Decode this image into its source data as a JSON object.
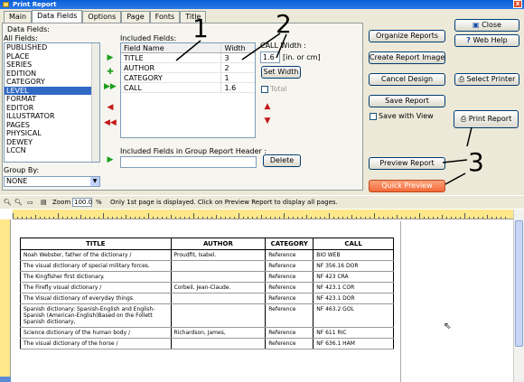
{
  "window": {
    "title": "Print Report",
    "close_glyph": "x"
  },
  "tabs": [
    {
      "label": "Main"
    },
    {
      "label": "Data Fields"
    },
    {
      "label": "Options"
    },
    {
      "label": "Page"
    },
    {
      "label": "Fonts"
    },
    {
      "label": "Title"
    }
  ],
  "data_fields": {
    "group_label": "Data Fields:",
    "all_fields_label": "All Fields:",
    "all_fields": [
      "PUBLISHED",
      "PLACE",
      "SERIES",
      "EDITION",
      "CATEGORY",
      "LEVEL",
      "FORMAT",
      "EDITOR",
      "ILLUSTRATOR",
      "PAGES",
      "PHYSICAL",
      "DEWEY",
      "LCCN"
    ],
    "selected_field": "LEVEL",
    "included_label": "Included Fields:",
    "columns": [
      "Field Name",
      "Width"
    ],
    "included": [
      {
        "name": "TITLE",
        "width": "3"
      },
      {
        "name": "AUTHOR",
        "width": "2"
      },
      {
        "name": "CATEGORY",
        "width": "1"
      },
      {
        "name": "CALL",
        "width": "1.6"
      }
    ],
    "call_width_label": "CALL Width :",
    "call_width_value": "1.6",
    "units_label": "[in. or cm]",
    "set_width": "Set Width",
    "total_label": "Total",
    "group_header_label": "Included Fields in Group Report Header :",
    "delete": "Delete",
    "group_by_label": "Group By:",
    "group_by_value": "NONE"
  },
  "side_buttons": {
    "organize": "Organize Reports",
    "create_image": "Create Report Image",
    "cancel_design": "Cancel Design",
    "save_report": "Save Report",
    "save_with_view": "Save with View",
    "preview_report": "Preview Report",
    "quick_preview": "Quick Preview",
    "close": "Close",
    "web_help": "Web Help",
    "select_printer": "Select Printer",
    "print_report": "Print Report"
  },
  "toolbar": {
    "zoom_label": "Zoom",
    "zoom_value": "100.0",
    "percent": "%",
    "note": "Only 1st page is displayed. Click on Preview Report to display all pages."
  },
  "report": {
    "headers": [
      "TITLE",
      "AUTHOR",
      "CATEGORY",
      "CALL"
    ],
    "rows": [
      [
        "Noah Webster, father of the dictionary /",
        "Proudfit, Isabel.",
        "Reference",
        "BIO  WEB"
      ],
      [
        "The visual dictionary of special military forces.",
        "",
        "Reference",
        "NF 356.16 DOR"
      ],
      [
        "The Kingfisher first dictionary.",
        "",
        "Reference",
        "NF 423 CRA"
      ],
      [
        "The Firefly visual dictionary /",
        "Corbeil, Jean-Claude.",
        "Reference",
        "NF 423.1 COR"
      ],
      [
        "The Visual dictionary of everyday things.",
        "",
        "Reference",
        "NF 423.1 DOR"
      ],
      [
        "Spanish dictionary: Spanish-English and English-Spanish (American-English)Based on the Follett Spanish dictionary,",
        "",
        "Reference",
        "NF 463.2 GOL"
      ],
      [
        "Science dictionary of the human body /",
        "Richardson, James,",
        "Reference",
        "NF 611 RIC"
      ],
      [
        "The visual dictionary of the horse /",
        "",
        "Reference",
        "NF 636.1 HAM"
      ]
    ]
  },
  "annotations": {
    "one": "1",
    "two": "2",
    "three": "3"
  },
  "icons": {
    "close": "close-icon",
    "help": "help-icon",
    "printer": "printer-icon",
    "add": "add-icon",
    "add_all": "add-all-icon",
    "remove": "remove-icon",
    "remove_all": "remove-all-icon",
    "move_up": "move-up-icon",
    "move_down": "move-down-icon"
  },
  "colors": {
    "selection": "#316ac5",
    "quick_preview": "#f26b3a",
    "ruler": "#ffe88a",
    "titlebar": "#0a5fd8"
  }
}
